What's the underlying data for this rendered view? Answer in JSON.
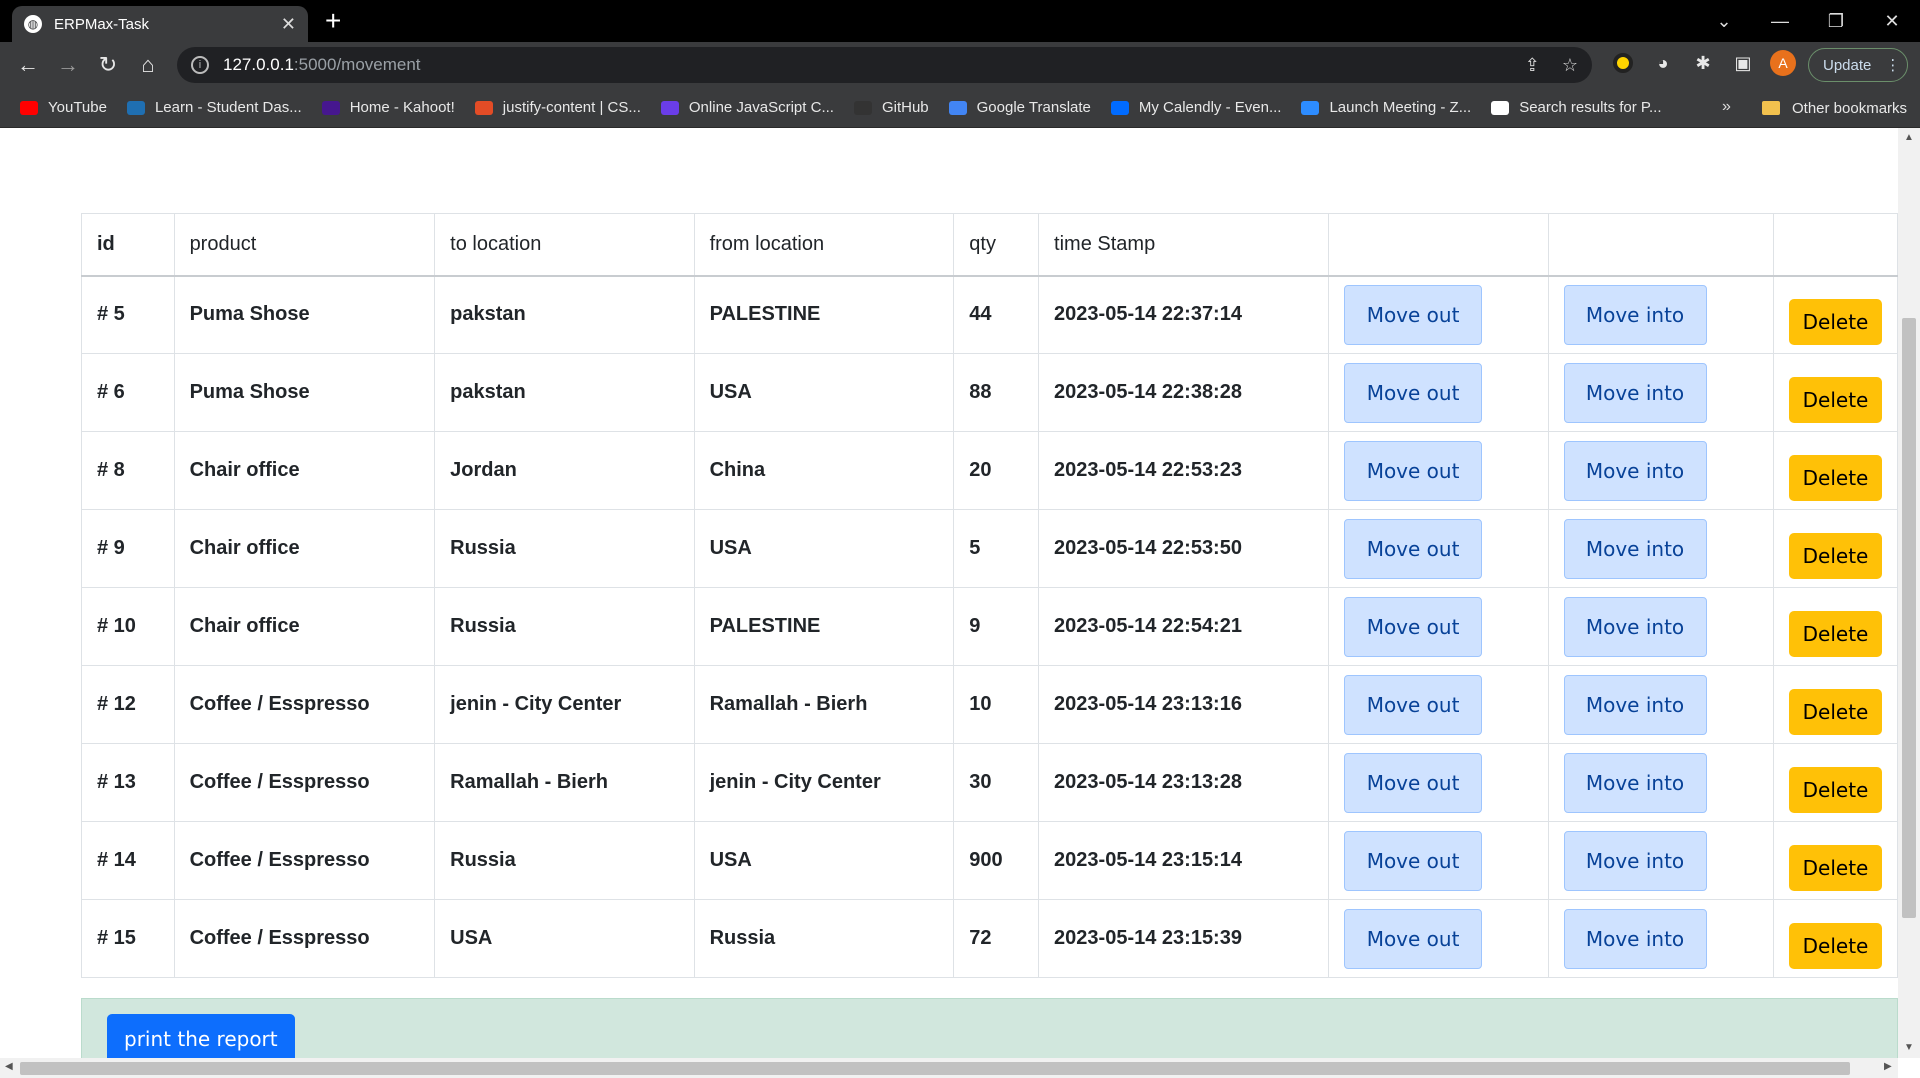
{
  "browser": {
    "tab_title": "ERPMax-Task",
    "tab_close": "✕",
    "new_tab": "+",
    "url_host": "127.0.0.1",
    "url_path": ":5000/movement",
    "update_label": "Update",
    "avatar_letter": "A",
    "bookmarks": [
      {
        "label": "YouTube",
        "color": "#ff0000"
      },
      {
        "label": "Learn - Student Das...",
        "color": "#1f6fb2"
      },
      {
        "label": "Home - Kahoot!",
        "color": "#46178f"
      },
      {
        "label": "justify-content | CS...",
        "color": "#e34c26"
      },
      {
        "label": "Online JavaScript C...",
        "color": "#6a3de8"
      },
      {
        "label": "GitHub",
        "color": "#333333"
      },
      {
        "label": "Google Translate",
        "color": "#4285f4"
      },
      {
        "label": "My Calendly - Even...",
        "color": "#006bff"
      },
      {
        "label": "Launch Meeting - Z...",
        "color": "#2d8cff"
      },
      {
        "label": "Search results for P...",
        "color": "#ffffff"
      }
    ],
    "bookmarks_more": "»",
    "other_bookmarks": "Other bookmarks"
  },
  "table": {
    "headers": [
      "id",
      "product",
      "to location",
      "from location",
      "qty",
      "time Stamp"
    ],
    "move_out_label": "Move out",
    "move_into_label": "Move into",
    "delete_label": "Delete",
    "rows": [
      {
        "id": "# 5",
        "product": "Puma Shose",
        "to": "pakstan",
        "from": "PALESTINE",
        "qty": "44",
        "ts": "2023-05-14 22:37:14"
      },
      {
        "id": "# 6",
        "product": "Puma Shose",
        "to": "pakstan",
        "from": "USA",
        "qty": "88",
        "ts": "2023-05-14 22:38:28"
      },
      {
        "id": "# 8",
        "product": "Chair office",
        "to": "Jordan",
        "from": "China",
        "qty": "20",
        "ts": "2023-05-14 22:53:23"
      },
      {
        "id": "# 9",
        "product": "Chair office",
        "to": "Russia",
        "from": "USA",
        "qty": "5",
        "ts": "2023-05-14 22:53:50"
      },
      {
        "id": "# 10",
        "product": "Chair office",
        "to": "Russia",
        "from": "PALESTINE",
        "qty": "9",
        "ts": "2023-05-14 22:54:21"
      },
      {
        "id": "# 12",
        "product": "Coffee / Esspresso",
        "to": "jenin - City Center",
        "from": "Ramallah - Bierh",
        "qty": "10",
        "ts": "2023-05-14 23:13:16"
      },
      {
        "id": "# 13",
        "product": "Coffee / Esspresso",
        "to": "Ramallah - Bierh",
        "from": "jenin - City Center",
        "qty": "30",
        "ts": "2023-05-14 23:13:28"
      },
      {
        "id": "# 14",
        "product": "Coffee / Esspresso",
        "to": "Russia",
        "from": "USA",
        "qty": "900",
        "ts": "2023-05-14 23:15:14"
      },
      {
        "id": "# 15",
        "product": "Coffee / Esspresso",
        "to": "USA",
        "from": "Russia",
        "qty": "72",
        "ts": "2023-05-14 23:15:39"
      }
    ]
  },
  "report": {
    "print_label": "print the report"
  }
}
